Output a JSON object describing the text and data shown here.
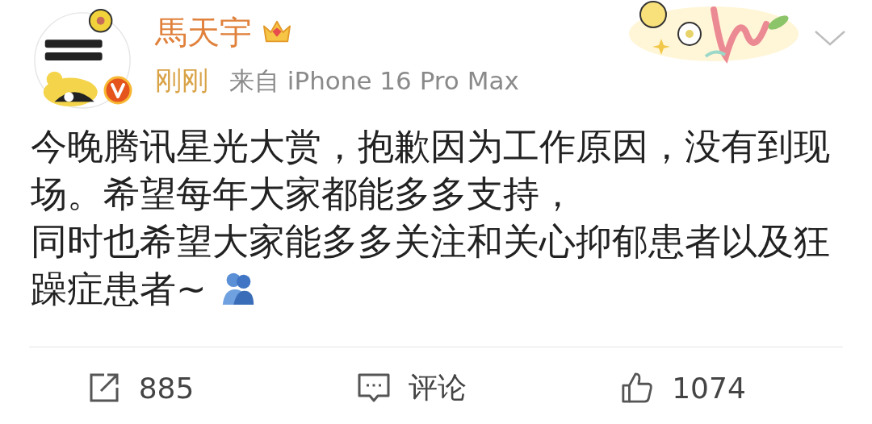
{
  "post": {
    "author": {
      "name": "馬天宇",
      "verified": true
    },
    "time": "刚刚",
    "source": "来自 iPhone 16 Pro Max",
    "paragraphs": [
      "今晚腾讯星光大赏，抱歉因为工作原因，没有到现场。希望每年大家都能多多支持，",
      "同时也希望大家能多多关注和关心抑郁患者以及狂躁症患者~"
    ],
    "actions": [
      {
        "kind": "repost",
        "label": "885"
      },
      {
        "kind": "comment",
        "label": "评论"
      },
      {
        "kind": "like",
        "label": "1074"
      }
    ]
  }
}
